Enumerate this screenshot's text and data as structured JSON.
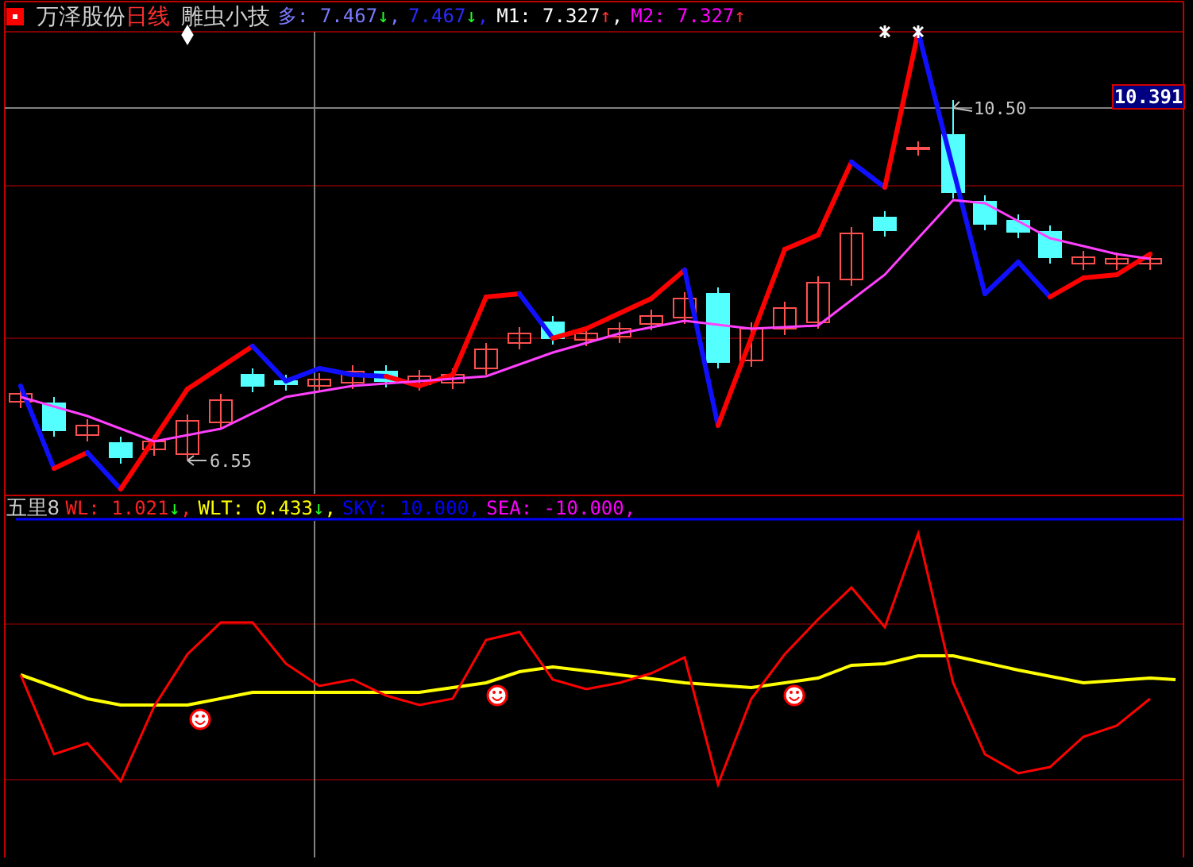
{
  "main_header": {
    "stock_name": "万泽股份",
    "period": "日线",
    "indicator": "雕虫小技",
    "values": [
      {
        "text": "多: 7.467",
        "arrow": "↓",
        "kind": "falling",
        "separator": ",",
        "color": "#7a7aff"
      },
      {
        "text": "7.467",
        "arrow": "↓",
        "kind": "falling",
        "separator": ",",
        "color": "#2a2aff"
      },
      {
        "text": "M1: 7.327",
        "arrow": "↑",
        "kind": "rising",
        "separator": ",",
        "color": "#ffffff"
      },
      {
        "text": "M2: 7.327",
        "arrow": "↑",
        "kind": "rising",
        "color": "#ff00ff"
      }
    ]
  },
  "price_chart": {
    "current_price": "10.391",
    "high_annotation": "10.50",
    "low_annotation": "6.55"
  },
  "lower_header": {
    "indicator": "五里8",
    "values": [
      {
        "text": "WL: 1.021",
        "arrow": "↓",
        "kind": "falling",
        "separator": ",",
        "color": "#ff2020"
      },
      {
        "text": "WLT: 0.433",
        "arrow": "↓",
        "kind": "falling",
        "separator": ",",
        "color": "#ffff00"
      },
      {
        "text": "SKY: 10.000",
        "separator": ",",
        "color": "#0000ff"
      },
      {
        "text": "SEA: -10.000",
        "separator": ",",
        "color": "#ff00ff"
      }
    ]
  }
}
